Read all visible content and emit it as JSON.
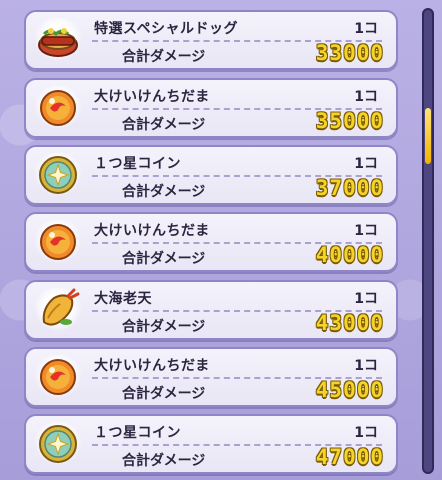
{
  "items": [
    {
      "name": "特選スペシャルドッグ",
      "count": "1コ",
      "damage_label": "合計ダメージ",
      "damage": "33000",
      "icon": "hotdog-icon"
    },
    {
      "name": "大けいけんちだま",
      "count": "1コ",
      "damage_label": "合計ダメージ",
      "damage": "35000",
      "icon": "exp-orb-icon"
    },
    {
      "name": "１つ星コイン",
      "count": "1コ",
      "damage_label": "合計ダメージ",
      "damage": "37000",
      "icon": "star-coin-icon"
    },
    {
      "name": "大けいけんちだま",
      "count": "1コ",
      "damage_label": "合計ダメージ",
      "damage": "40000",
      "icon": "exp-orb-icon"
    },
    {
      "name": "大海老天",
      "count": "1コ",
      "damage_label": "合計ダメージ",
      "damage": "43000",
      "icon": "shrimp-tempura-icon"
    },
    {
      "name": "大けいけんちだま",
      "count": "1コ",
      "damage_label": "合計ダメージ",
      "damage": "45000",
      "icon": "exp-orb-icon"
    },
    {
      "name": "１つ星コイン",
      "count": "1コ",
      "damage_label": "合計ダメージ",
      "damage": "47000",
      "icon": "star-coin-icon"
    }
  ],
  "scrollbar": {
    "position_fraction": 0.22
  },
  "colors": {
    "damage_value": "#f4d32a",
    "row_bg": "#f4f2fb",
    "row_border": "#8f86c7",
    "background": "#b3a9e0"
  }
}
